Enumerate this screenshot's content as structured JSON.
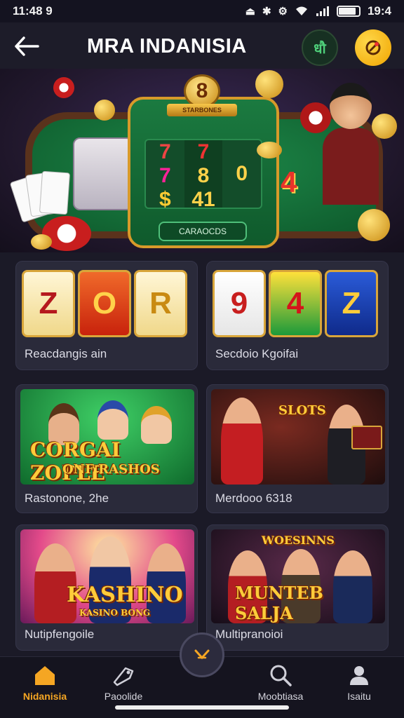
{
  "status_bar": {
    "time": "11:48 9",
    "right_text": "19:4",
    "battery_level": 0.85
  },
  "header": {
    "title": "MRA INDANISIA",
    "green_button_text": "धौ"
  },
  "hero": {
    "medal_number": "8",
    "medal_banner": "STARBONES",
    "reel_left": [
      "7",
      "7",
      "$"
    ],
    "reel_mid": [
      "7",
      "8",
      "41"
    ],
    "reel_right": [
      "",
      "0",
      ""
    ],
    "side_number": "4",
    "button_label": "CARAOCDS"
  },
  "games": [
    {
      "label": "Reacdangis ain",
      "symbols": [
        "Z",
        "O",
        "R"
      ]
    },
    {
      "label": "Secdoio Kgoifai",
      "symbols": [
        "9",
        "4",
        "Z"
      ]
    },
    {
      "label": "Rastonone, 2he",
      "art_title": "CORGAI ZOPLE",
      "art_subtitle": "ONF RASHOS"
    },
    {
      "label": "Merdooo 6318",
      "art_title": "SLOTS"
    },
    {
      "label": "Nutipfengoile",
      "art_title": "KASHINO",
      "art_subtitle": "KASINO BONG"
    },
    {
      "label": "Multipranoioi",
      "art_title": "MUNTEB SALJA",
      "art_top_banner": "WOESINNS"
    }
  ],
  "bottom_nav": {
    "items": [
      {
        "label": "Nidanisia",
        "icon": "home-icon",
        "active": true
      },
      {
        "label": "Paoolide",
        "icon": "tag-icon",
        "active": false
      },
      {
        "label": "Moobtiasa",
        "icon": "search-icon",
        "active": false
      },
      {
        "label": "Isaitu",
        "icon": "user-icon",
        "active": false
      }
    ]
  },
  "colors": {
    "accent": "#f5a623",
    "background": "#1b1a27",
    "tile": "#2a2a3a"
  }
}
